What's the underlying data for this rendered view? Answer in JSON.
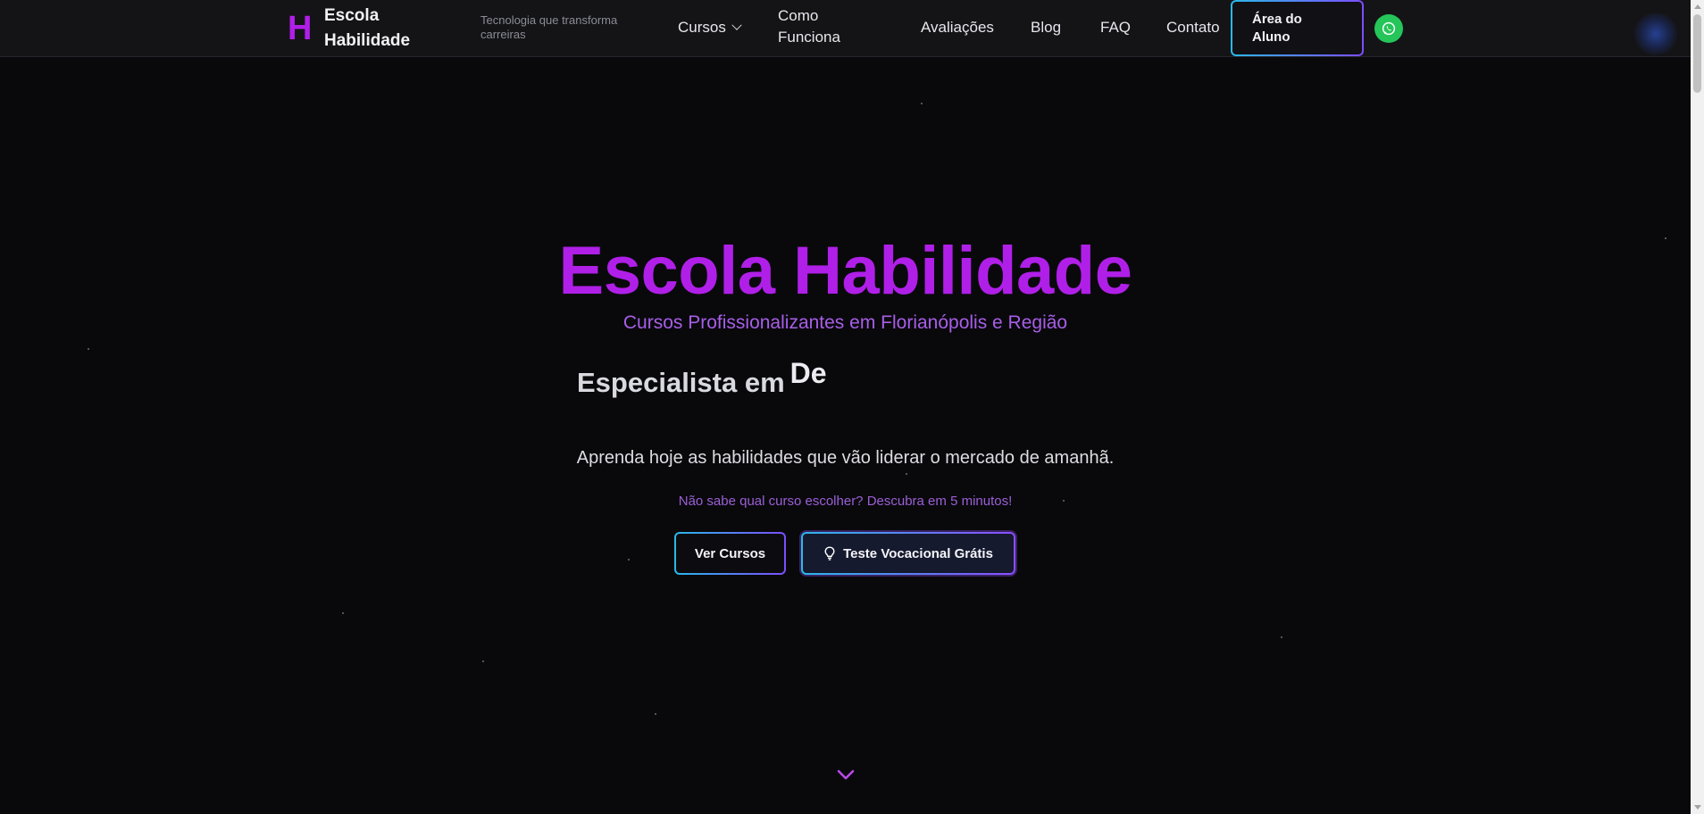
{
  "header": {
    "logo_mark": "H",
    "logo_text": "Escola Habilidade",
    "tagline": "Tecnologia que transforma carreiras",
    "nav": {
      "courses": "Cursos",
      "how_it_works": "Como Funciona",
      "reviews": "Avaliações",
      "blog": "Blog",
      "faq": "FAQ",
      "contact": "Contato"
    },
    "student_area": "Área do Aluno",
    "whatsapp_icon": "whatsapp-icon"
  },
  "hero": {
    "title": "Escola Habilidade",
    "subtitle": "Cursos Profissionalizantes em Florianópolis e Região",
    "specialist_prefix": "Especialista em",
    "specialist_typed": "De",
    "tagline": "Aprenda hoje as habilidades que vão liderar o mercado de amanhã.",
    "quiz_hint": "Não sabe qual curso escolher? Descubra em 5 minutos!",
    "btn_courses": "Ver Cursos",
    "btn_test": "Teste Vocacional Grátis",
    "btn_test_icon": "lightbulb-icon",
    "scroll_icon": "chevron-down-icon"
  },
  "colors": {
    "background": "#09090c",
    "header_bg": "#141417",
    "brand_purple": "#b01fe8",
    "subtitle_purple": "#a85ee8",
    "whatsapp_green": "#25c55a",
    "gradient_cyan": "#2bb8e8",
    "gradient_violet": "#7c4dff"
  }
}
